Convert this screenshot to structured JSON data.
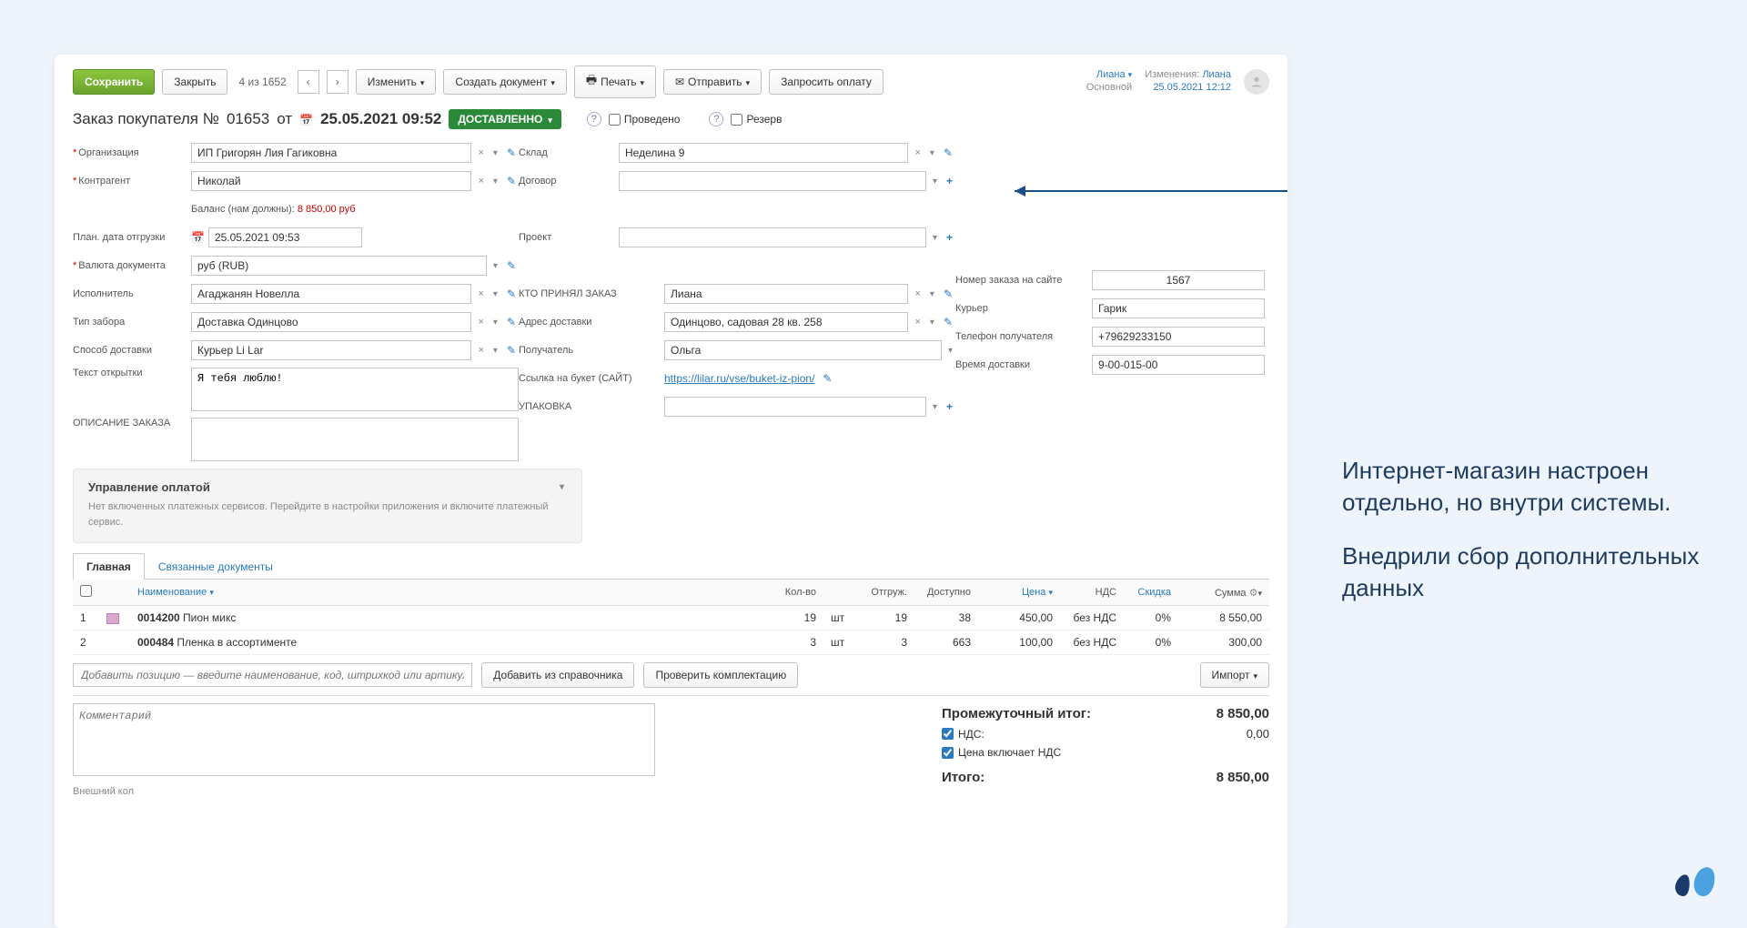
{
  "toolbar": {
    "save": "Сохранить",
    "close": "Закрыть",
    "page": "4 из 1652",
    "change": "Изменить",
    "create_doc": "Создать документ",
    "print": "Печать",
    "send": "Отправить",
    "request_pay": "Запросить оплату"
  },
  "user": {
    "name": "Лиана",
    "sub": "Основной",
    "change_label": "Изменения:",
    "change_user": "Лиана",
    "change_ts": "25.05.2021 12:12"
  },
  "title": {
    "prefix": "Заказ покупателя №",
    "num": "01653",
    "from": "от",
    "date": "25.05.2021 09:52",
    "status": "ДОСТАВЛЕННО",
    "conducted": "Проведено",
    "reserve": "Резерв"
  },
  "fields": {
    "org_label": "Организация",
    "org_value": "ИП Григорян Лия Гагиковна",
    "counter_label": "Контрагент",
    "counter_value": "Николай",
    "balance_label": "Баланс (нам должны):",
    "balance_value": "8 850,00 руб",
    "ship_date_label": "План. дата отгрузки",
    "ship_date_value": "25.05.2021 09:53",
    "currency_label": "Валюта документа",
    "currency_value": "руб (RUB)",
    "executor_label": "Исполнитель",
    "executor_value": "Агаджанян Новелла",
    "pickup_label": "Тип забора",
    "pickup_value": "Доставка Одинцово",
    "delivery_label": "Способ доставки",
    "delivery_value": "Курьер Li Lar",
    "card_label": "Текст открытки",
    "card_value": "Я тебя люблю!",
    "desc_label": "ОПИСАНИЕ ЗАКАЗА",
    "warehouse_label": "Склад",
    "warehouse_value": "Неделина 9",
    "contract_label": "Договор",
    "project_label": "Проект",
    "who_label": "КТО ПРИНЯЛ ЗАКАЗ",
    "who_value": "Лиана",
    "addr_label": "Адрес доставки",
    "addr_value": "Одинцово, садовая 28 кв. 258",
    "recip_label": "Получатель",
    "recip_value": "Ольга",
    "link_label": "Ссылка на букет (САЙТ)",
    "link_value": "https://lilar.ru/vse/buket-iz-pion/",
    "pack_label": "УПАКОВКА",
    "site_order_label": "Номер заказа на сайте",
    "site_order_value": "1567",
    "courier_label": "Курьер",
    "courier_value": "Гарик",
    "phone_label": "Телефон получателя",
    "phone_value": "+79629233150",
    "dtime_label": "Время доставки",
    "dtime_value": "9-00-015-00"
  },
  "pay_panel": {
    "head": "Управление оплатой",
    "body": "Нет включенных платежных сервисов. Перейдите в настройки приложения и включите платежный сервис."
  },
  "tabs": {
    "main": "Главная",
    "linked": "Связанные документы"
  },
  "table": {
    "headers": {
      "name": "Наименование",
      "qty": "Кол-во",
      "shipped": "Отгруж.",
      "avail": "Доступно",
      "price": "Цена",
      "vat": "НДС",
      "discount": "Скидка",
      "sum": "Сумма"
    },
    "rows": [
      {
        "n": "1",
        "code": "0014200",
        "name": "Пион микс",
        "qty": "19",
        "unit": "шт",
        "shipped": "19",
        "avail": "38",
        "price": "450,00",
        "vat": "без НДС",
        "disc": "0%",
        "sum": "8 550,00",
        "thumb": true
      },
      {
        "n": "2",
        "code": "000484",
        "name": "Пленка в ассортименте",
        "qty": "3",
        "unit": "шт",
        "shipped": "3",
        "avail": "663",
        "price": "100,00",
        "vat": "без НДС",
        "disc": "0%",
        "sum": "300,00",
        "thumb": false
      }
    ],
    "add_placeholder": "Добавить позицию — введите наименование, код, штрихкод или артикул",
    "btn_add_dir": "Добавить из справочника",
    "btn_check": "Проверить комплектацию",
    "btn_import": "Импорт"
  },
  "comment_placeholder": "Комментарий",
  "totals": {
    "subtotal_label": "Промежуточный итог:",
    "subtotal_value": "8 850,00",
    "vat_label": "НДС:",
    "vat_value": "0,00",
    "vat_included_label": "Цена включает НДС",
    "total_label": "Итого:",
    "total_value": "8 850,00"
  },
  "external_code": "Внешний кол",
  "side_text": {
    "p1": "Интернет-магазин настроен отдельно, но внутри системы.",
    "p2": "Внедрили сбор дополнительных данных"
  }
}
